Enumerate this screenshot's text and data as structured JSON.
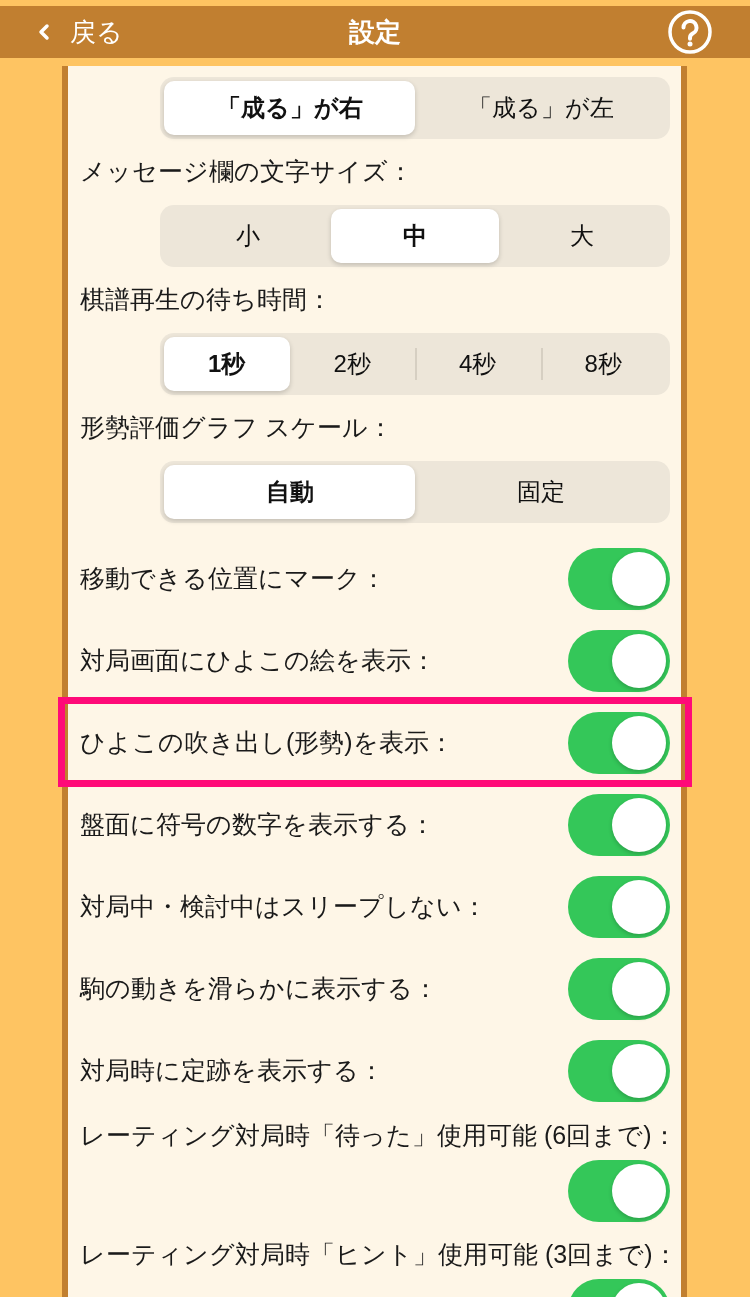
{
  "header": {
    "back_label": "戻る",
    "title": "設定"
  },
  "settings": [
    {
      "kind": "segmented",
      "options": [
        {
          "label": "「成る」が右",
          "selected": true
        },
        {
          "label": "「成る」が左",
          "selected": false
        }
      ]
    },
    {
      "kind": "segmented",
      "label": "メッセージ欄の文字サイズ：",
      "options": [
        {
          "label": "小",
          "selected": false
        },
        {
          "label": "中",
          "selected": true
        },
        {
          "label": "大",
          "selected": false
        }
      ]
    },
    {
      "kind": "segmented",
      "label": "棋譜再生の待ち時間：",
      "options": [
        {
          "label": "1秒",
          "selected": true
        },
        {
          "label": "2秒",
          "selected": false
        },
        {
          "label": "4秒",
          "selected": false
        },
        {
          "label": "8秒",
          "selected": false
        }
      ]
    },
    {
      "kind": "segmented",
      "label": "形勢評価グラフ スケール：",
      "options": [
        {
          "label": "自動",
          "selected": true
        },
        {
          "label": "固定",
          "selected": false
        }
      ]
    },
    {
      "kind": "toggle",
      "label": "移動できる位置にマーク：",
      "on": true,
      "highlighted": false
    },
    {
      "kind": "toggle",
      "label": "対局画面にひよこの絵を表示：",
      "on": true,
      "highlighted": false
    },
    {
      "kind": "toggle",
      "label": "ひよこの吹き出し(形勢)を表示：",
      "on": true,
      "highlighted": true
    },
    {
      "kind": "toggle",
      "label": "盤面に符号の数字を表示する：",
      "on": true,
      "highlighted": false
    },
    {
      "kind": "toggle",
      "label": "対局中・検討中はスリープしない：",
      "on": true,
      "highlighted": false
    },
    {
      "kind": "toggle",
      "label": "駒の動きを滑らかに表示する：",
      "on": true,
      "highlighted": false
    },
    {
      "kind": "toggle",
      "label": "対局時に定跡を表示する：",
      "on": true,
      "highlighted": false
    },
    {
      "kind": "toggle_below",
      "label": "レーティング対局時「待った」使用可能 (6回まで)：",
      "on": true,
      "highlighted": false
    },
    {
      "kind": "toggle_below",
      "label": "レーティング対局時「ヒント」使用可能 (3回まで)：",
      "on": true,
      "highlighted": false
    }
  ]
}
